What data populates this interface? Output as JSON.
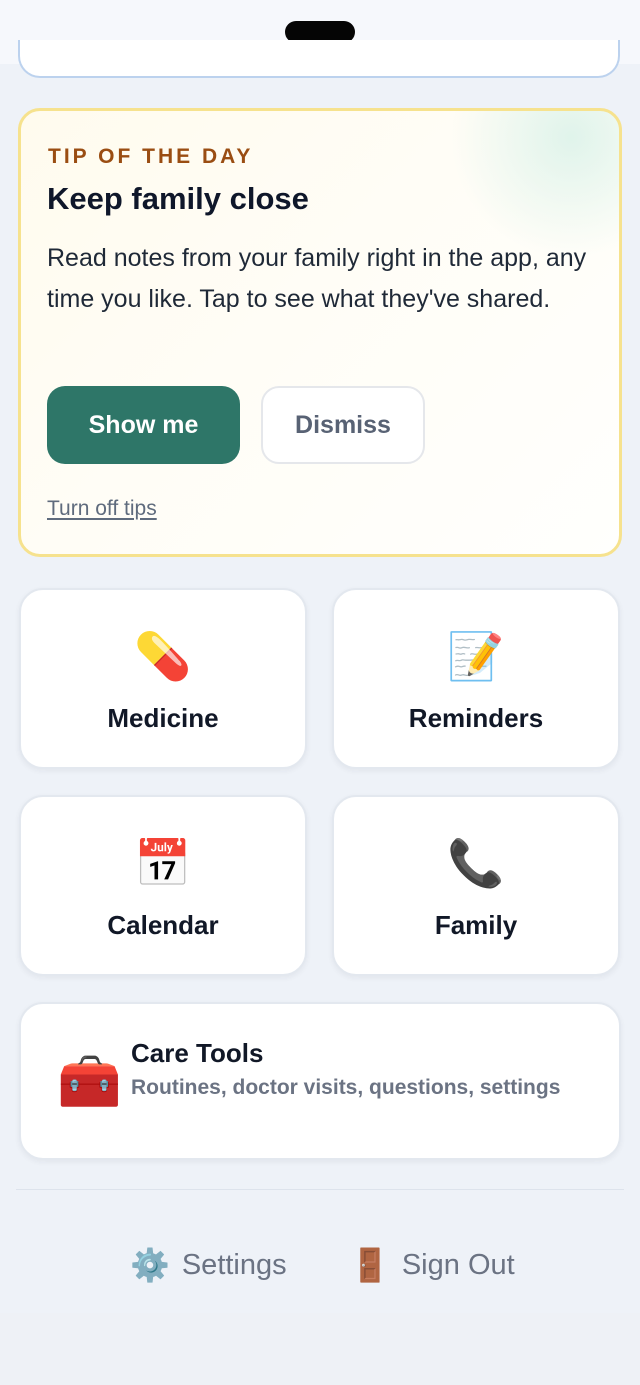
{
  "tip": {
    "eyebrow": "TIP OF THE DAY",
    "title": "Keep family close",
    "body": "Read notes from your family right in the app, any time you like. Tap to see what they've shared.",
    "primary_label": "Show me",
    "secondary_label": "Dismiss",
    "turn_off_label": "Turn off tips"
  },
  "tiles": [
    {
      "label": "Medicine",
      "icon": "💊",
      "icon_name": "pill-icon"
    },
    {
      "label": "Reminders",
      "icon": "📝",
      "icon_name": "memo-icon"
    },
    {
      "label": "Calendar",
      "icon": "📅",
      "icon_name": "calendar-icon"
    },
    {
      "label": "Family",
      "icon": "📞",
      "icon_name": "phone-icon"
    }
  ],
  "care_tools": {
    "title": "Care Tools",
    "subtitle": "Routines, doctor visits, questions, settings",
    "icon": "🧰",
    "icon_name": "toolbox-icon"
  },
  "footer": {
    "settings_label": "Settings",
    "settings_icon": "⚙️",
    "signout_label": "Sign Out",
    "signout_icon": "🚪"
  },
  "colors": {
    "primary": "#2e7668",
    "eyebrow": "#9a4d12",
    "tip_border": "#f6e28e",
    "muted_text": "#6b7383"
  }
}
